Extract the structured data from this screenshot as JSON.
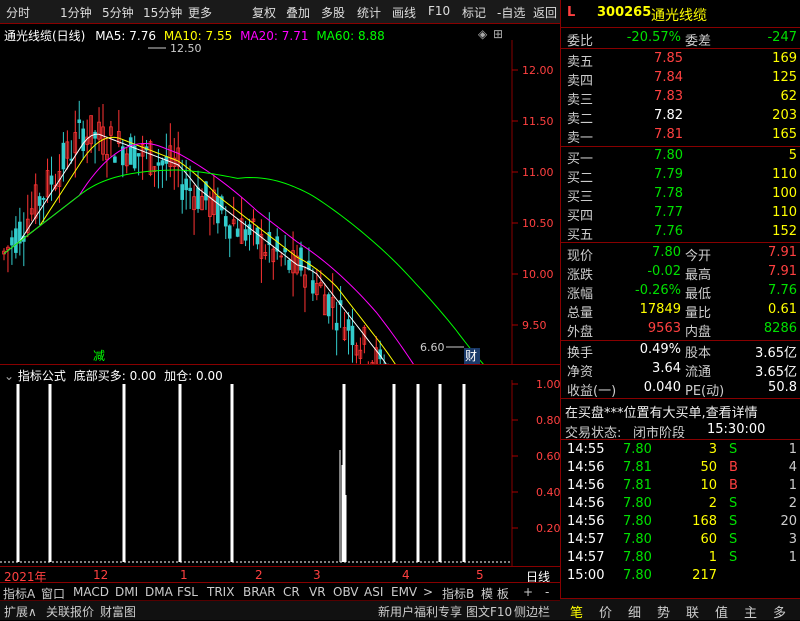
{
  "toolbar": {
    "left": [
      "分时",
      "1分钟",
      "5分钟",
      "15分钟",
      "更多"
    ],
    "right": [
      "复权",
      "叠加",
      "多股",
      "统计",
      "画线",
      "F10",
      "标记",
      "-自选",
      "返回"
    ]
  },
  "chart": {
    "title": "通光线缆(日线)",
    "ma": [
      {
        "label": "MA5: 7.76",
        "color": "#ffffff"
      },
      {
        "label": "MA10: 7.55",
        "color": "#ffff00"
      },
      {
        "label": "MA20: 7.71",
        "color": "#ff00ff"
      },
      {
        "label": "MA60: 8.88",
        "color": "#00ff00"
      }
    ],
    "high_label": "12.50",
    "low_label": "6.60",
    "mark_jian": "减",
    "mark_cai": "财",
    "yticks": [
      "12.00",
      "11.50",
      "11.00",
      "10.50",
      "10.00",
      "9.50",
      "9.00",
      "8.50",
      "8.00",
      "7.50",
      "7.00"
    ]
  },
  "indicator": {
    "title": "指标公式",
    "sub": "底部买多: 0.00",
    "sub2": "加仓: 0.00",
    "yticks": [
      "1.00",
      "0.80",
      "0.60",
      "0.40",
      "0.20"
    ]
  },
  "xaxis": {
    "labels": [
      "2021年",
      "12",
      "1",
      "2",
      "3",
      "4",
      "5"
    ],
    "right": "日线"
  },
  "tabs_bar": [
    "指标A",
    "窗口",
    "MACD",
    "DMI",
    "DMA",
    "FSL",
    "TRIX",
    "BRAR",
    "CR",
    "VR",
    "OBV",
    "ASI",
    "EMV",
    ">",
    "指标B",
    "模 板",
    "+",
    "-"
  ],
  "bottom_bar": [
    "扩展∧",
    "关联报价",
    "财富图",
    "新用户福利专享",
    "图文F10",
    "侧边栏"
  ],
  "quote": {
    "code": "300265",
    "name": "通光线缆",
    "flag": "L",
    "wei_bi_label": "委比",
    "wei_bi": "-20.57%",
    "wei_cha_label": "委差",
    "wei_cha": "-247",
    "sell": [
      {
        "label": "卖五",
        "price": "7.85",
        "vol": "169"
      },
      {
        "label": "卖四",
        "price": "7.84",
        "vol": "125"
      },
      {
        "label": "卖三",
        "price": "7.83",
        "vol": "62"
      },
      {
        "label": "卖二",
        "price": "7.82",
        "vol": "203"
      },
      {
        "label": "卖一",
        "price": "7.81",
        "vol": "165"
      }
    ],
    "buy": [
      {
        "label": "买一",
        "price": "7.80",
        "vol": "5"
      },
      {
        "label": "买二",
        "price": "7.79",
        "vol": "110"
      },
      {
        "label": "买三",
        "price": "7.78",
        "vol": "100"
      },
      {
        "label": "买四",
        "price": "7.77",
        "vol": "110"
      },
      {
        "label": "买五",
        "price": "7.76",
        "vol": "152"
      }
    ],
    "stats": [
      [
        "现价",
        "7.80",
        "今开",
        "7.91"
      ],
      [
        "涨跌",
        "-0.02",
        "最高",
        "7.91"
      ],
      [
        "涨幅",
        "-0.26%",
        "最低",
        "7.76"
      ],
      [
        "总量",
        "17849",
        "量比",
        "0.61"
      ],
      [
        "外盘",
        "9563",
        "内盘",
        "8286"
      ]
    ],
    "stats2": [
      [
        "换手",
        "0.49%",
        "股本",
        "3.65亿"
      ],
      [
        "净资",
        "3.64",
        "流通",
        "3.65亿"
      ],
      [
        "收益(一)",
        "0.040",
        "PE(动)",
        "50.8"
      ]
    ],
    "notice": "在买盘***位置有大买单,查看详情",
    "status_label": "交易状态:",
    "status": "闭市阶段",
    "status_time": "15:30:00",
    "ticks": [
      [
        "14:55",
        "7.80",
        "3",
        "S",
        "1"
      ],
      [
        "14:56",
        "7.81",
        "50",
        "B",
        "4"
      ],
      [
        "14:56",
        "7.81",
        "10",
        "B",
        "1"
      ],
      [
        "14:56",
        "7.80",
        "2",
        "S",
        "2"
      ],
      [
        "14:56",
        "7.80",
        "168",
        "S",
        "20"
      ],
      [
        "14:57",
        "7.80",
        "60",
        "S",
        "3"
      ],
      [
        "14:57",
        "7.80",
        "1",
        "S",
        "1"
      ],
      [
        "15:00",
        "7.80",
        "217",
        "",
        ""
      ]
    ],
    "tabs": [
      "笔",
      "价",
      "细",
      "势",
      "联",
      "值",
      "主",
      "多"
    ]
  }
}
